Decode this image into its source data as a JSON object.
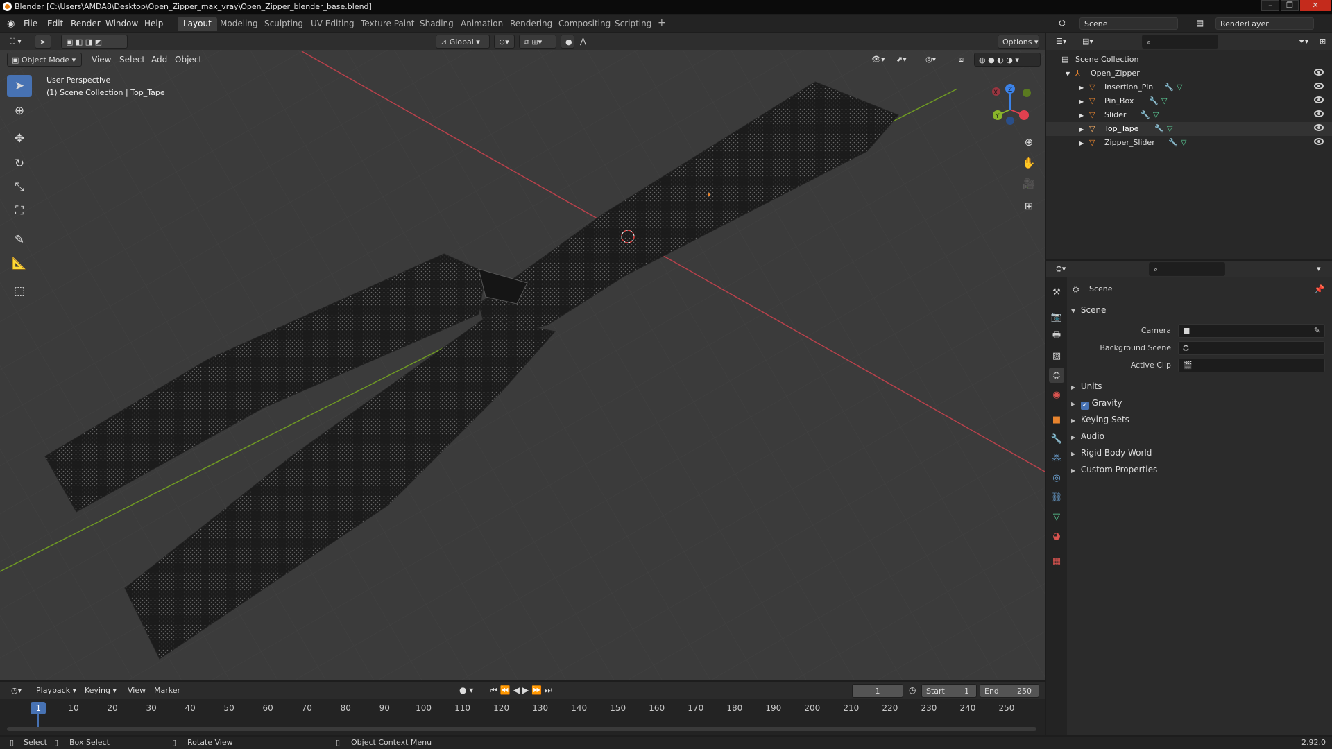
{
  "window": {
    "title": "Blender [C:\\Users\\AMDA8\\Desktop\\Open_Zipper_max_vray\\Open_Zipper_blender_base.blend]"
  },
  "menubar": {
    "items": [
      "File",
      "Edit",
      "Render",
      "Window",
      "Help"
    ],
    "workspaces": [
      "Layout",
      "Modeling",
      "Sculpting",
      "UV Editing",
      "Texture Paint",
      "Shading",
      "Animation",
      "Rendering",
      "Compositing",
      "Scripting"
    ],
    "active_workspace": "Layout",
    "add_tab": "+",
    "scene_name": "Scene",
    "view_layer": "RenderLayer"
  },
  "viewport": {
    "transform_orientation": "Global",
    "options_label": "Options",
    "mode": "Object Mode",
    "menus": [
      "View",
      "Select",
      "Add",
      "Object"
    ],
    "perspective_label": "User Perspective",
    "collection_label": "(1) Scene Collection | Top_Tape",
    "gizmo_axes": {
      "x": "X",
      "y": "Y",
      "z": "Z"
    }
  },
  "outliner": {
    "root": "Scene Collection",
    "collection": "Open_Zipper",
    "objects": [
      "Insertion_Pin",
      "Pin_Box",
      "Slider",
      "Top_Tape",
      "Zipper_Slider"
    ]
  },
  "properties": {
    "context_title": "Scene",
    "panel_title": "Scene",
    "fields": {
      "camera": "Camera",
      "background_scene": "Background Scene",
      "active_clip": "Active Clip"
    },
    "panels": [
      "Units",
      "Gravity",
      "Keying Sets",
      "Audio",
      "Rigid Body World",
      "Custom Properties"
    ],
    "gravity_checked": true
  },
  "timeline": {
    "menus": [
      "Playback",
      "Keying",
      "View",
      "Marker"
    ],
    "current_frame": "1",
    "start_label": "Start",
    "start": "1",
    "end_label": "End",
    "end": "250",
    "ticks": [
      "1",
      "10",
      "20",
      "30",
      "40",
      "50",
      "60",
      "70",
      "80",
      "90",
      "100",
      "110",
      "120",
      "130",
      "140",
      "150",
      "160",
      "170",
      "180",
      "190",
      "200",
      "210",
      "220",
      "230",
      "240",
      "250"
    ]
  },
  "statusbar": {
    "select": "Select",
    "box_select": "Box Select",
    "rotate_view": "Rotate View",
    "context_menu": "Object Context Menu",
    "version": "2.92.0"
  },
  "colors": {
    "accent": "#4772b3",
    "x_axis": "#e0404f",
    "y_axis": "#8ab52a",
    "z_axis": "#3b82e8",
    "object_orange": "#e8842e"
  }
}
